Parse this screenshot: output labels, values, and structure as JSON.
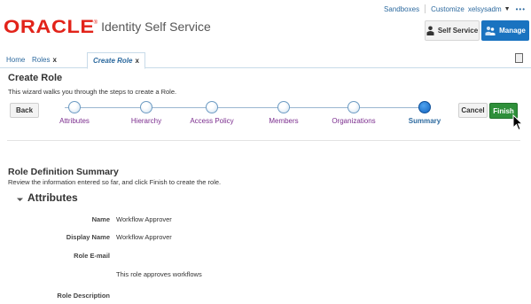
{
  "header": {
    "logo_text": "ORACLE",
    "logo_reg": "®",
    "product": "Identity Self Service",
    "links": {
      "sandboxes": "Sandboxes",
      "customize": "Customize",
      "user": "xelsysadm",
      "more": "•••"
    },
    "self_service_label": "Self Service",
    "manage_label": "Manage",
    "accent": "#1a73c0",
    "brand": "#e2231a"
  },
  "tabs": {
    "home": "Home",
    "roles": "Roles",
    "create_role": "Create Role",
    "close_symbol": "x"
  },
  "wizard": {
    "title": "Create Role",
    "description": "This wizard walks you through the steps to create a Role.",
    "back_label": "Back",
    "cancel_label": "Cancel",
    "finish_label": "Finish",
    "steps": [
      {
        "label": "Attributes",
        "current": false
      },
      {
        "label": "Hierarchy",
        "current": false
      },
      {
        "label": "Access Policy",
        "current": false
      },
      {
        "label": "Members",
        "current": false
      },
      {
        "label": "Organizations",
        "current": false
      },
      {
        "label": "Summary",
        "current": true
      }
    ],
    "finish_color": "#2e8f3a"
  },
  "summary": {
    "title": "Role Definition Summary",
    "description": "Review the information entered so far, and click Finish to create the role.",
    "section_title": "Attributes",
    "fields": [
      {
        "label": "Name",
        "value": "Workflow Approver"
      },
      {
        "label": "Display Name",
        "value": "Workflow Approver"
      },
      {
        "label": "Role E-mail",
        "value": ""
      },
      {
        "label": "",
        "value": "This role approves workflows"
      },
      {
        "label": "Role Description",
        "value": ""
      }
    ]
  }
}
